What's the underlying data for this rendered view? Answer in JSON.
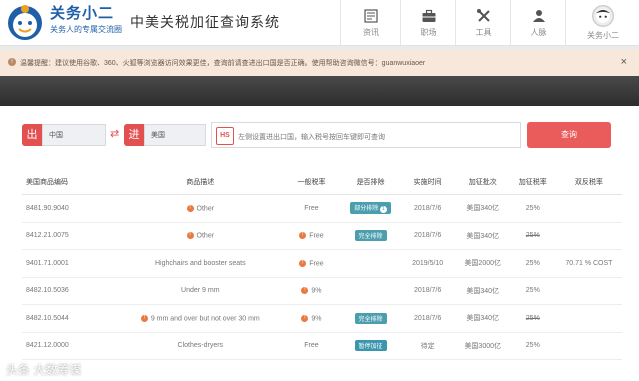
{
  "brand": {
    "name": "关务小二",
    "slogan": "关务人的专属交流圈"
  },
  "site_title": "中美关税加征查询系统",
  "nav": [
    {
      "label": "资讯",
      "icon": "newspaper-icon"
    },
    {
      "label": "职场",
      "icon": "briefcase-icon"
    },
    {
      "label": "工具",
      "icon": "tools-icon"
    },
    {
      "label": "人脉",
      "icon": "people-icon"
    },
    {
      "label": "关务小二",
      "icon": "user-avatar-icon"
    }
  ],
  "notice": {
    "text": "温馨提醒：建议使用谷歌、360、火狐等浏览器访问效果更佳，查询前请查进出口国是否正确。使用帮助咨询微信号：guanwuxiaoer",
    "close": "×"
  },
  "search": {
    "export_tag": "出",
    "export_country": "中国",
    "swap": "⇄",
    "import_tag": "进",
    "import_country": "美国",
    "hs_badge": "HS",
    "placeholder": "左侧设置进出口国，输入税号按回车键即可查询",
    "button": "查询"
  },
  "table": {
    "headers": [
      "美国商品编码",
      "商品描述",
      "一般税率",
      "是否排除",
      "实施时间",
      "加征批次",
      "加征税率",
      "双反税率"
    ],
    "rows": [
      {
        "code": "8481.90.9040",
        "desc": "Other",
        "rate": "Free",
        "exclude": "部分排除",
        "exclude_has_info": "1",
        "date": "2018/7/6",
        "batch": "美国340亿",
        "add_rate": "25%",
        "strike": false,
        "ad": ""
      },
      {
        "code": "8412.21.0075",
        "desc": "Other",
        "rate": "Free",
        "exclude": "完全排除",
        "date": "2018/7/6",
        "batch": "美国340亿",
        "add_rate": "25%",
        "strike": true,
        "ad": ""
      },
      {
        "code": "9401.71.0001",
        "desc": "Highchairs and booster seats",
        "rate": "Free",
        "exclude": "",
        "date": "2019/5/10",
        "batch": "美国2000亿",
        "add_rate": "25%",
        "strike": false,
        "ad": "70.71 % COST"
      },
      {
        "code": "8482.10.5036",
        "desc": "Under 9 mm",
        "rate": "9%",
        "exclude": "",
        "date": "2018/7/6",
        "batch": "美国340亿",
        "add_rate": "25%",
        "strike": false,
        "ad": ""
      },
      {
        "code": "8482.10.5044",
        "desc": "9 mm and over but not over 30 mm",
        "rate": "9%",
        "exclude": "完全排除",
        "date": "2018/7/6",
        "batch": "美国340亿",
        "add_rate": "25%",
        "strike": true,
        "ad": ""
      },
      {
        "code": "8421.12.0000",
        "desc": "Clothes-dryers",
        "rate": "Free",
        "exclude": "暂停加征",
        "date": "待定",
        "batch": "美国3000亿",
        "add_rate": "25%",
        "strike": false,
        "ad": ""
      }
    ]
  },
  "watermark": "头条 大数筹谋",
  "colors": {
    "accent": "#ea5b5b",
    "brand": "#1f5fa8",
    "badge": "#4a9eae",
    "dot": "#e9793d"
  }
}
